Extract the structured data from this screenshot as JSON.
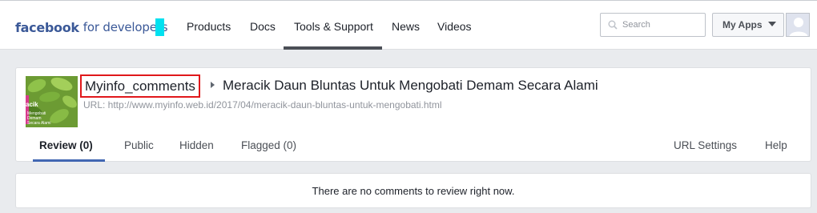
{
  "header": {
    "brand_bold": "facebook",
    "brand_rest": "for developers",
    "nav": [
      {
        "label": "Products"
      },
      {
        "label": "Docs"
      },
      {
        "label": "Tools & Support"
      },
      {
        "label": "News"
      },
      {
        "label": "Videos"
      }
    ],
    "search_placeholder": "Search",
    "my_apps_label": "My Apps"
  },
  "page": {
    "thumbnail_text_1": "acik",
    "thumbnail_text_2": "Mengobati\nDemam\nSecara Alami",
    "app_name": "Myinfo_comments",
    "title": "Meracik Daun Bluntas Untuk Mengobati Demam Secara Alami",
    "url_line": "URL: http://www.myinfo.web.id/2017/04/meracik-daun-bluntas-untuk-mengobati.html",
    "tabs": [
      {
        "label": "Review (0)"
      },
      {
        "label": "Public"
      },
      {
        "label": "Hidden"
      },
      {
        "label": "Flagged (0)"
      }
    ],
    "right_tabs": [
      {
        "label": "URL Settings"
      },
      {
        "label": "Help"
      }
    ],
    "empty_message": "There are no comments to review right now."
  },
  "colors": {
    "brand_blue": "#3b5998",
    "tab_active_underline": "#4267b2",
    "highlight_box": "#e0181b",
    "cursor_cyan": "#00e1f0"
  }
}
